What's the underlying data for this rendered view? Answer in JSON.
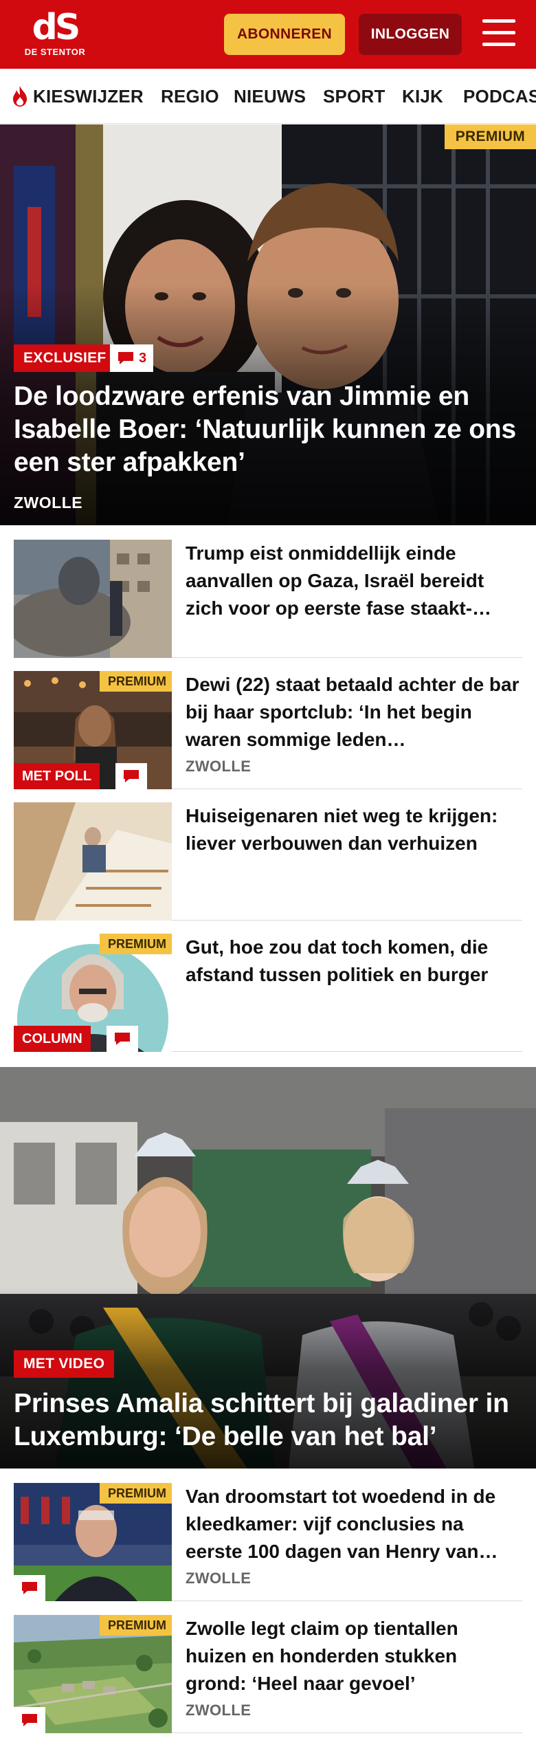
{
  "header": {
    "logo_mark": "dS",
    "logo_name": "DE STENTOR",
    "subscribe_label": "ABONNEREN",
    "login_label": "INLOGGEN",
    "menu_icon": "hamburger-icon",
    "brand_red": "#d10a10",
    "premium_yellow": "#f5c343"
  },
  "nav": {
    "items": [
      {
        "label": "KIESWIJZER",
        "icon": "flame-icon"
      },
      {
        "label": "REGIO"
      },
      {
        "label": "NIEUWS"
      },
      {
        "label": "SPORT"
      },
      {
        "label": "KIJK"
      },
      {
        "label": "PODCAS"
      }
    ]
  },
  "hero1": {
    "premium": "PREMIUM",
    "tag": "EXCLUSIEF",
    "comments": "3",
    "title": "De loodzware erfenis van Jimmie en Isabelle Boer: ‘Natuurlijk kunnen ze ons een ster afpakken’",
    "category": "ZWOLLE"
  },
  "articles1": [
    {
      "title": "Trump eist onmiddellijk einde aanvallen op Gaza, Israël bereidt zich voor op eerste fase staakt-…"
    },
    {
      "premium": "PREMIUM",
      "tag": "MET POLL",
      "title": "Dewi (22) staat betaald achter de bar bij haar sportclub: ‘In het begin waren sommige leden…",
      "category": "ZWOLLE"
    },
    {
      "title": "Huiseigenaren niet weg te krijgen: liever verbouwen dan verhuizen"
    },
    {
      "premium": "PREMIUM",
      "tag": "COLUMN",
      "title": "Gut, hoe zou dat toch komen, die afstand tussen politiek en burger"
    }
  ],
  "hero2": {
    "tag": "MET VIDEO",
    "title": "Prinses Amalia schittert bij galadiner in Luxemburg: ‘De belle van het bal’"
  },
  "articles2": [
    {
      "premium": "PREMIUM",
      "title": "Van droomstart tot woedend in de kleedkamer: vijf conclusies na eerste 100 dagen van Henry van…",
      "category": "ZWOLLE"
    },
    {
      "premium": "PREMIUM",
      "title": "Zwolle legt claim op tientallen huizen en honderden stukken grond: ‘Heel naar gevoel’",
      "category": "ZWOLLE"
    }
  ]
}
